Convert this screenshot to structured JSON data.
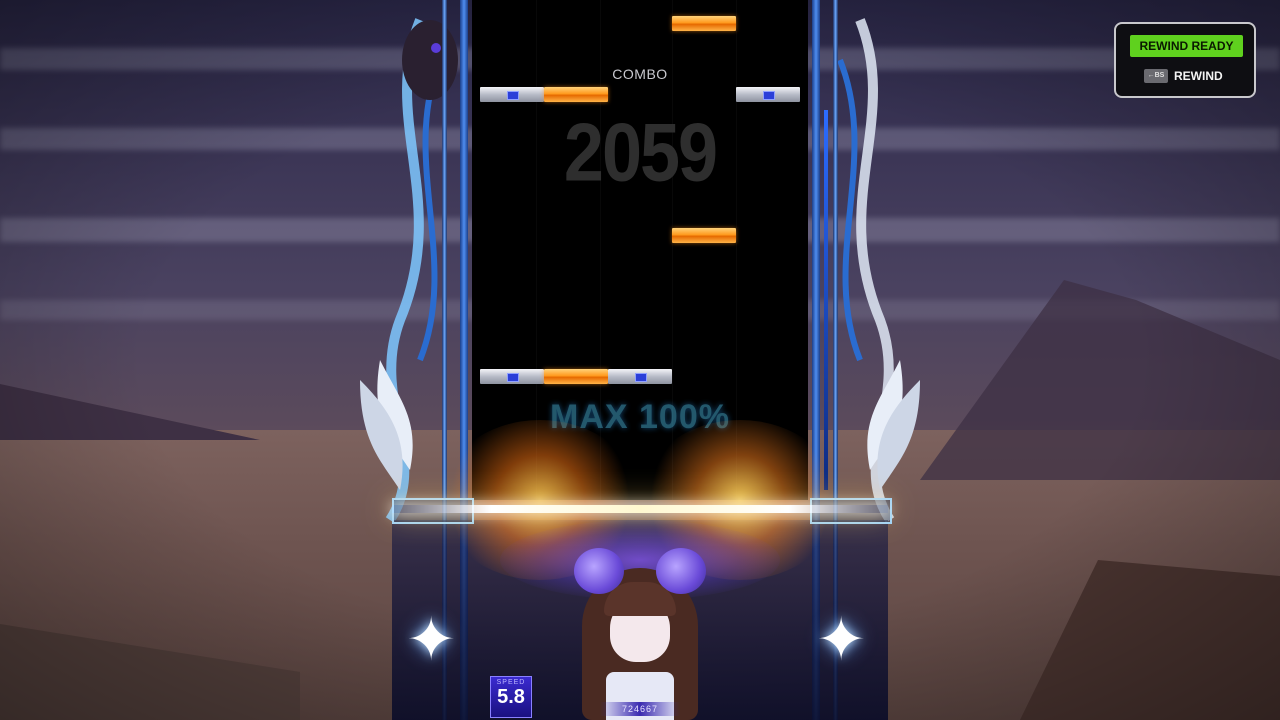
{
  "lane": {
    "combo_label": "COMBO",
    "combo_count": "2059",
    "judgement_text": "MAX 100%"
  },
  "notes": [
    {
      "type": "orange",
      "lane": 4
    },
    {
      "type": "white",
      "lane": 1
    },
    {
      "type": "orange",
      "lane": 2
    },
    {
      "type": "white",
      "lane": 6
    },
    {
      "type": "orange",
      "lane": 4
    },
    {
      "type": "white",
      "lane": 1
    },
    {
      "type": "orange",
      "lane": 2
    },
    {
      "type": "white",
      "lane": 3
    }
  ],
  "hud": {
    "speed_label": "SPEED",
    "speed_value": "5.8",
    "score": "724667"
  },
  "rewind": {
    "status": "REWIND READY",
    "key": "←BS",
    "action": "REWIND",
    "status_color": "#5fd11e"
  },
  "colors": {
    "orange_note": "#ff9a1e",
    "white_note": "#b8bcc8",
    "lane_frame": "#4f8ef0"
  }
}
